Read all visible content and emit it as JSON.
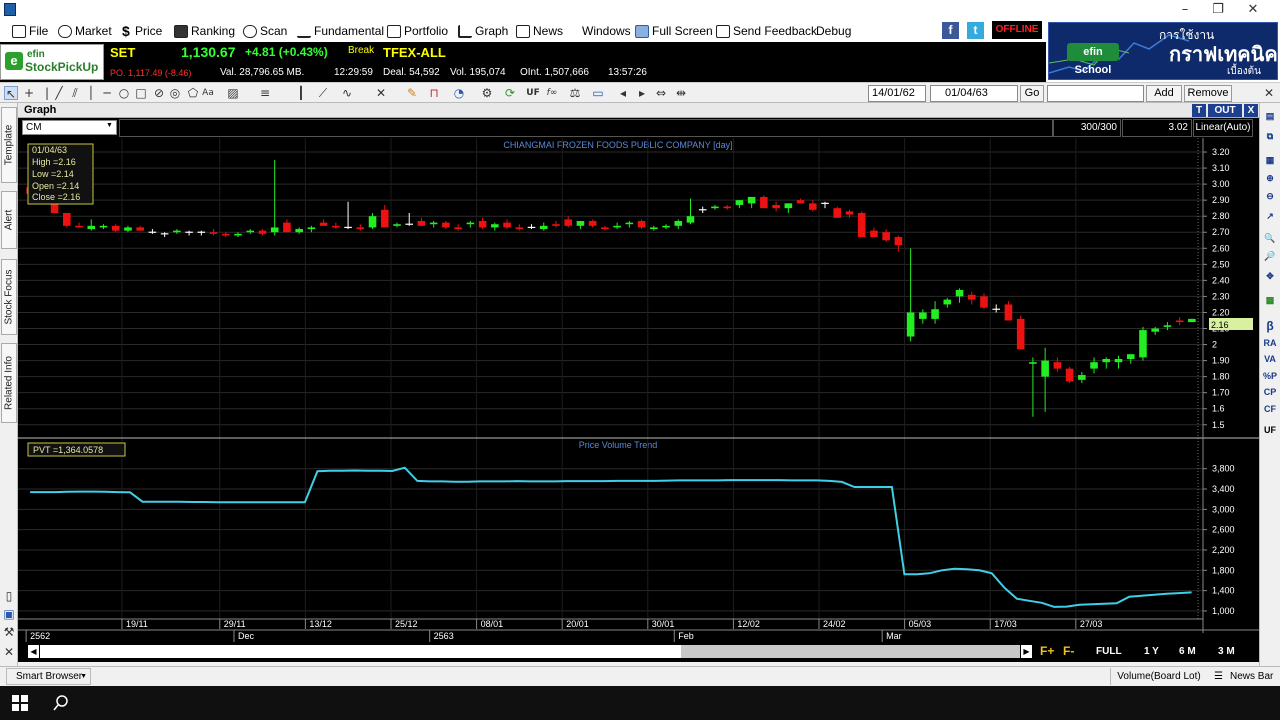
{
  "menu": {
    "items": [
      "File",
      "Market",
      "Price",
      "Ranking",
      "Scan",
      "Fundamental",
      "Portfolio",
      "Graph",
      "News",
      "Windows",
      "Full Screen",
      "Send Feedback",
      "Debug"
    ],
    "status": "OFFLINE"
  },
  "logo": {
    "line1": "efin",
    "line2": "StockPickUp"
  },
  "market": {
    "set_label": "SET",
    "set_value": "1,130.67",
    "set_change": "+4.81 (+0.43%)",
    "break_label": "Break",
    "po": "PO. 1,117.49 (-8.46)",
    "value": "Val. 28,796.65 MB.",
    "set_time": "12:29:59",
    "tfex_label": "TFEX-ALL",
    "deal": "Deal. 54,592",
    "volume": "Vol. 195,074",
    "oi": "OInt. 1,507,666",
    "tfex_time": "13:57:26"
  },
  "banner": {
    "line1": "การใช้งาน",
    "line2": "กราฟเทคนิค",
    "line3": "เบื้องต้น",
    "school": "efin School"
  },
  "toolbar": {
    "date_from": "14/01/62",
    "date_to": "01/04/63",
    "go_label": "Go",
    "add_label": "Add",
    "remove_label": "Remove"
  },
  "graph": {
    "panel_title": "Graph",
    "t_label": "T",
    "out_label": "OUT",
    "close_label": "X",
    "symbol": "CM",
    "bar_count": "300/300",
    "scale_value": "3.02",
    "scale_mode": "Linear(Auto)",
    "chart_title": "CHIANGMAI FROZEN FOODS PUBLIC COMPANY [day]",
    "indicator_title": "Price Volume Trend",
    "ohlc_box": {
      "date": "01/04/63",
      "high": "High  =2.16",
      "low": "Low   =2.14",
      "open": "Open  =2.14",
      "close": "Close  =2.16"
    },
    "pvt_box": "PVT  =1,364.0578",
    "price_tag": "2.16"
  },
  "left_tabs": [
    "Template",
    "Alert",
    "Stock Focus",
    "Related Info"
  ],
  "right_icons": [
    "β",
    "RA",
    "VA",
    "%P",
    "CP",
    "CF",
    "UF"
  ],
  "scroll": {
    "full": "FULL",
    "one_year": "1 Y",
    "six_month": "6 M",
    "three_month": "3 M",
    "f_plus": "F+",
    "f_minus": "F-"
  },
  "status": {
    "smart_browser": "Smart Browser",
    "volume": "Volume(Board Lot)",
    "news_bar": "News Bar"
  },
  "chart_data": {
    "type": "candlestick",
    "title": "CHIANGMAI FROZEN FOODS PUBLIC COMPANY [day]",
    "y_ticks": [
      3.2,
      3.1,
      3.0,
      2.9,
      2.8,
      2.7,
      2.6,
      2.5,
      2.4,
      2.3,
      2.2,
      2.1,
      2.0,
      1.9,
      1.8,
      1.7,
      1.6,
      1.5
    ],
    "y_tick_labels": [
      "3.20",
      "3.10",
      "3.00",
      "2.90",
      "2.80",
      "2.70",
      "2.60",
      "2.50",
      "2.40",
      "2.30",
      "2.20",
      "2.10",
      "2",
      "1.90",
      "1.80",
      "1.70",
      "1.6",
      "1.5"
    ],
    "ylim": [
      1.43,
      3.25
    ],
    "x_labels": [
      "19/11",
      "29/11",
      "13/12",
      "25/12",
      "08/01",
      "20/01",
      "30/01",
      "12/02",
      "24/02",
      "05/03",
      "17/03",
      "27/03"
    ],
    "x_label_bar_index": [
      8,
      16,
      23,
      30,
      37,
      44,
      51,
      58,
      65,
      72,
      79,
      86
    ],
    "period_labels": [
      "2562",
      "Dec",
      "2563",
      "Feb",
      "Mar"
    ],
    "period_bar_index": [
      0,
      17,
      33,
      53,
      70
    ],
    "candles": [
      [
        2.98,
        3.02,
        2.94,
        2.94
      ],
      [
        2.95,
        2.96,
        2.88,
        2.89
      ],
      [
        2.89,
        2.9,
        2.82,
        2.82
      ],
      [
        2.82,
        2.82,
        2.73,
        2.74
      ],
      [
        2.74,
        2.76,
        2.73,
        2.73
      ],
      [
        2.72,
        2.78,
        2.71,
        2.74
      ],
      [
        2.73,
        2.75,
        2.72,
        2.74
      ],
      [
        2.74,
        2.75,
        2.7,
        2.71
      ],
      [
        2.71,
        2.74,
        2.7,
        2.73
      ],
      [
        2.73,
        2.74,
        2.71,
        2.71
      ],
      [
        2.7,
        2.72,
        2.69,
        2.7
      ],
      [
        2.69,
        2.7,
        2.67,
        2.69
      ],
      [
        2.7,
        2.72,
        2.69,
        2.71
      ],
      [
        2.7,
        2.71,
        2.68,
        2.7
      ],
      [
        2.7,
        2.71,
        2.68,
        2.7
      ],
      [
        2.7,
        2.72,
        2.68,
        2.69
      ],
      [
        2.69,
        2.7,
        2.67,
        2.68
      ],
      [
        2.68,
        2.7,
        2.67,
        2.69
      ],
      [
        2.7,
        2.72,
        2.69,
        2.71
      ],
      [
        2.71,
        2.72,
        2.68,
        2.69
      ],
      [
        2.7,
        3.15,
        2.68,
        2.73
      ],
      [
        2.76,
        2.78,
        2.7,
        2.7
      ],
      [
        2.7,
        2.73,
        2.69,
        2.72
      ],
      [
        2.72,
        2.74,
        2.7,
        2.73
      ],
      [
        2.76,
        2.78,
        2.74,
        2.74
      ],
      [
        2.74,
        2.76,
        2.72,
        2.73
      ],
      [
        2.73,
        2.89,
        2.72,
        2.73
      ],
      [
        2.73,
        2.75,
        2.71,
        2.72
      ],
      [
        2.73,
        2.82,
        2.72,
        2.8
      ],
      [
        2.84,
        2.87,
        2.73,
        2.73
      ],
      [
        2.74,
        2.76,
        2.73,
        2.75
      ],
      [
        2.75,
        2.82,
        2.74,
        2.75
      ],
      [
        2.77,
        2.79,
        2.74,
        2.74
      ],
      [
        2.75,
        2.77,
        2.73,
        2.76
      ],
      [
        2.76,
        2.77,
        2.72,
        2.73
      ],
      [
        2.73,
        2.75,
        2.71,
        2.72
      ],
      [
        2.75,
        2.77,
        2.73,
        2.76
      ],
      [
        2.77,
        2.79,
        2.72,
        2.73
      ],
      [
        2.73,
        2.76,
        2.71,
        2.75
      ],
      [
        2.76,
        2.78,
        2.72,
        2.73
      ],
      [
        2.73,
        2.75,
        2.71,
        2.72
      ],
      [
        2.73,
        2.75,
        2.72,
        2.73
      ],
      [
        2.72,
        2.76,
        2.71,
        2.74
      ],
      [
        2.75,
        2.77,
        2.73,
        2.74
      ],
      [
        2.78,
        2.8,
        2.73,
        2.74
      ],
      [
        2.74,
        2.76,
        2.72,
        2.77
      ],
      [
        2.77,
        2.78,
        2.73,
        2.74
      ],
      [
        2.73,
        2.74,
        2.71,
        2.72
      ],
      [
        2.73,
        2.76,
        2.72,
        2.74
      ],
      [
        2.75,
        2.77,
        2.73,
        2.76
      ],
      [
        2.77,
        2.78,
        2.72,
        2.73
      ],
      [
        2.72,
        2.74,
        2.71,
        2.73
      ],
      [
        2.73,
        2.75,
        2.72,
        2.74
      ],
      [
        2.74,
        2.78,
        2.72,
        2.77
      ],
      [
        2.76,
        2.91,
        2.75,
        2.8
      ],
      [
        2.84,
        2.86,
        2.82,
        2.84
      ],
      [
        2.85,
        2.87,
        2.84,
        2.86
      ],
      [
        2.86,
        2.87,
        2.84,
        2.85
      ],
      [
        2.87,
        2.9,
        2.85,
        2.9
      ],
      [
        2.88,
        2.92,
        2.85,
        2.92
      ],
      [
        2.92,
        2.93,
        2.85,
        2.85
      ],
      [
        2.87,
        2.89,
        2.83,
        2.85
      ],
      [
        2.85,
        2.88,
        2.82,
        2.88
      ],
      [
        2.9,
        2.91,
        2.88,
        2.88
      ],
      [
        2.88,
        2.9,
        2.83,
        2.84
      ],
      [
        2.88,
        2.89,
        2.85,
        2.88
      ],
      [
        2.85,
        2.86,
        2.79,
        2.79
      ],
      [
        2.83,
        2.84,
        2.79,
        2.81
      ],
      [
        2.82,
        2.83,
        2.67,
        2.67
      ],
      [
        2.71,
        2.73,
        2.67,
        2.67
      ],
      [
        2.7,
        2.72,
        2.64,
        2.65
      ],
      [
        2.67,
        2.68,
        2.58,
        2.62
      ],
      [
        2.05,
        2.6,
        2.02,
        2.2
      ],
      [
        2.16,
        2.22,
        2.13,
        2.2
      ],
      [
        2.16,
        2.27,
        2.13,
        2.22
      ],
      [
        2.25,
        2.29,
        2.23,
        2.28
      ],
      [
        2.3,
        2.35,
        2.26,
        2.34
      ],
      [
        2.31,
        2.33,
        2.25,
        2.28
      ],
      [
        2.3,
        2.32,
        2.22,
        2.23
      ],
      [
        2.22,
        2.25,
        2.2,
        2.22
      ],
      [
        2.25,
        2.27,
        2.15,
        2.15
      ],
      [
        2.16,
        2.18,
        1.97,
        1.97
      ],
      [
        1.88,
        1.92,
        1.55,
        1.89
      ],
      [
        1.8,
        1.98,
        1.58,
        1.9
      ],
      [
        1.89,
        1.92,
        1.83,
        1.85
      ],
      [
        1.85,
        1.86,
        1.76,
        1.77
      ],
      [
        1.78,
        1.83,
        1.76,
        1.81
      ],
      [
        1.85,
        1.92,
        1.82,
        1.89
      ],
      [
        1.89,
        1.92,
        1.85,
        1.91
      ],
      [
        1.89,
        1.93,
        1.85,
        1.91
      ],
      [
        1.91,
        1.93,
        1.88,
        1.94
      ],
      [
        1.92,
        2.11,
        1.9,
        2.09
      ],
      [
        2.08,
        2.11,
        2.06,
        2.1
      ],
      [
        2.11,
        2.14,
        2.09,
        2.12
      ],
      [
        2.15,
        2.17,
        2.12,
        2.14
      ],
      [
        2.14,
        2.16,
        2.14,
        2.16
      ]
    ],
    "indicator": {
      "name": "PVT",
      "y_ticks": [
        3800,
        3400,
        3000,
        2600,
        2200,
        1800,
        1400,
        1000
      ],
      "y_tick_labels": [
        "3,800",
        "3,400",
        "3,000",
        "2,600",
        "2,200",
        "1,800",
        "1,400",
        "1,000"
      ],
      "ylim": [
        900,
        4050
      ],
      "values": [
        3340,
        3340,
        3340,
        3345,
        3350,
        3350,
        3345,
        3340,
        3335,
        3150,
        3150,
        3150,
        3150,
        3145,
        3145,
        3140,
        3140,
        3140,
        3140,
        3140,
        3140,
        3140,
        3140,
        3750,
        3760,
        3760,
        3765,
        3760,
        3760,
        3755,
        3820,
        3560,
        3550,
        3550,
        3545,
        3545,
        3550,
        3550,
        3550,
        3555,
        3550,
        3550,
        3550,
        3555,
        3555,
        3555,
        3555,
        3560,
        3560,
        3560,
        3560,
        3565,
        3570,
        3570,
        3570,
        3570,
        3575,
        3575,
        3575,
        3575,
        3575,
        3570,
        3570,
        3570,
        3560,
        3540,
        3440,
        3440,
        3440,
        3440,
        1720,
        1720,
        1740,
        1800,
        1830,
        1820,
        1800,
        1740,
        1460,
        1240,
        1200,
        1160,
        1080,
        1085,
        1120,
        1130,
        1140,
        1150,
        1280,
        1300,
        1320,
        1340,
        1350,
        1364
      ]
    }
  }
}
